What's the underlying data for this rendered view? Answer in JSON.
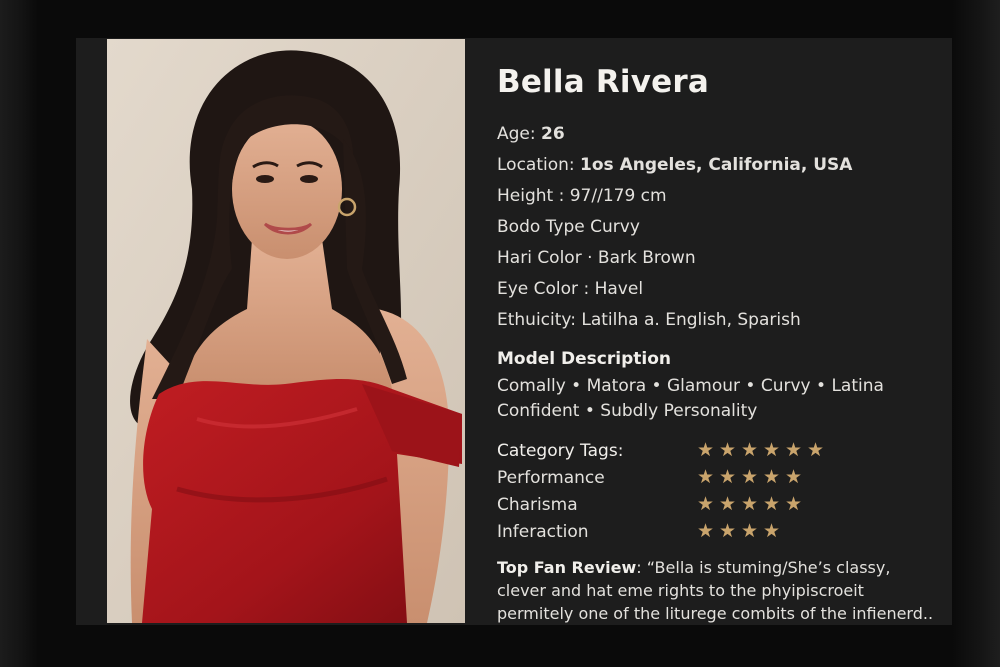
{
  "profile": {
    "name": "Bella Rivera",
    "attributes": [
      {
        "label": "Age: ",
        "value": "26"
      },
      {
        "label": "Location: ",
        "value": "1os Angeles, California, USA"
      },
      {
        "label": "Height : ",
        "value": "97//179 cm"
      },
      {
        "label": "Bodo Type  ",
        "value": "Curvy"
      },
      {
        "label": "Hari Color · ",
        "value": "Bark Brown"
      },
      {
        "label": "Eye Color : ",
        "value": "Havel"
      },
      {
        "label": "Ethuicity: ",
        "value": "Latilha a. English, Sparish"
      }
    ],
    "description_title": "Model Description",
    "description_lines": [
      "Comally • Matora • Glamour • Curvy • Latina",
      "Confident • Subdly Personality"
    ],
    "category_tags": [
      {
        "label": "Category Tags:",
        "stars": 6
      },
      {
        "label": "Performance",
        "stars": 5
      },
      {
        "label": "Charisma",
        "stars": 5
      },
      {
        "label": "Inferaction",
        "stars": 4
      }
    ],
    "review_label": "Top Fan Review",
    "review_text": ": “Bella is stuming/She’s classy,  clever and hat eme rights to the phyipiscroeit permitely one of the liturege combits of the infienerd.."
  },
  "colors": {
    "accent_star": "#c9a46c",
    "panel_bg": "#1d1d1d",
    "dress_red": "#b3161c",
    "hair": "#1f1613"
  },
  "icons": {
    "rating": "star-icon"
  }
}
